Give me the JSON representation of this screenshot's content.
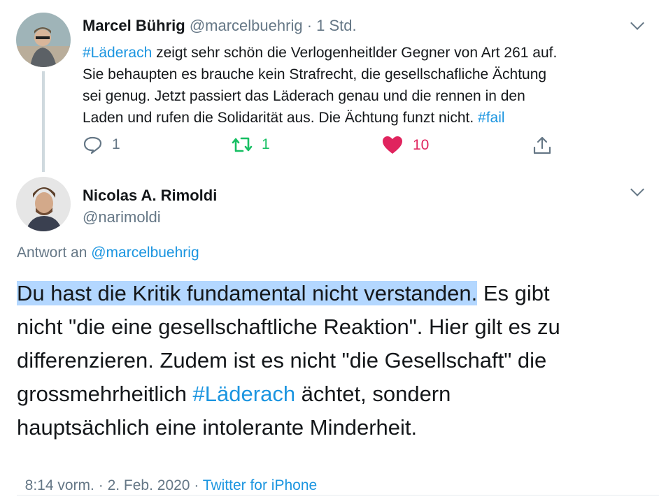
{
  "tweet1": {
    "name": "Marcel Bührig",
    "handle": "@marcelbuehrig",
    "sep": "·",
    "time": "1 Std.",
    "hashtag1": "#Läderach",
    "text1": " zeigt sehr schön die Verlogenheitlder Gegner von Art 261 auf.",
    "line2": "Sie behaupten es brauche kein Strafrecht, die gesellschafliche Ächtung",
    "line3": "sei genug. Jetzt passiert das Läderach genau und die rennen in den",
    "line4a": "Laden und rufen die Solidarität aus. Die Ächtung funzt nicht. ",
    "hashtag2": "#fail",
    "reply_count": "1",
    "retweet_count": "1",
    "like_count": "10"
  },
  "tweet2": {
    "name": "Nicolas A. Rimoldi",
    "handle": "@narimoldi",
    "reply_to_label": "Antwort an ",
    "reply_to_handle": "@marcelbuehrig",
    "body_highlight": "Du hast die Kritik fundamental nicht verstanden.",
    "body_1": " Es gibt",
    "body_2": "nicht \"die eine gesellschaftliche Reaktion\". Hier gilt es zu",
    "body_3": "differenzieren. Zudem ist es nicht \"die Gesellschaft\" die",
    "body_4a": "grossmehrheitlich ",
    "body_hashtag": "#Läderach",
    "body_4b": " ächtet, sondern",
    "body_5": "hauptsächlich eine intolerante Minderheit.",
    "time": "8:14 vorm.",
    "sep1": " · ",
    "date": "2. Feb. 2020",
    "sep2": " · ",
    "source": "Twitter for iPhone"
  },
  "colors": {
    "link": "#1b95e0",
    "retweet": "#17bf63",
    "like": "#e0245e",
    "muted": "#657786",
    "highlight": "#b3d7ff"
  },
  "icons": [
    "chevron-down-icon",
    "reply-icon",
    "retweet-icon",
    "heart-icon",
    "share-icon"
  ]
}
